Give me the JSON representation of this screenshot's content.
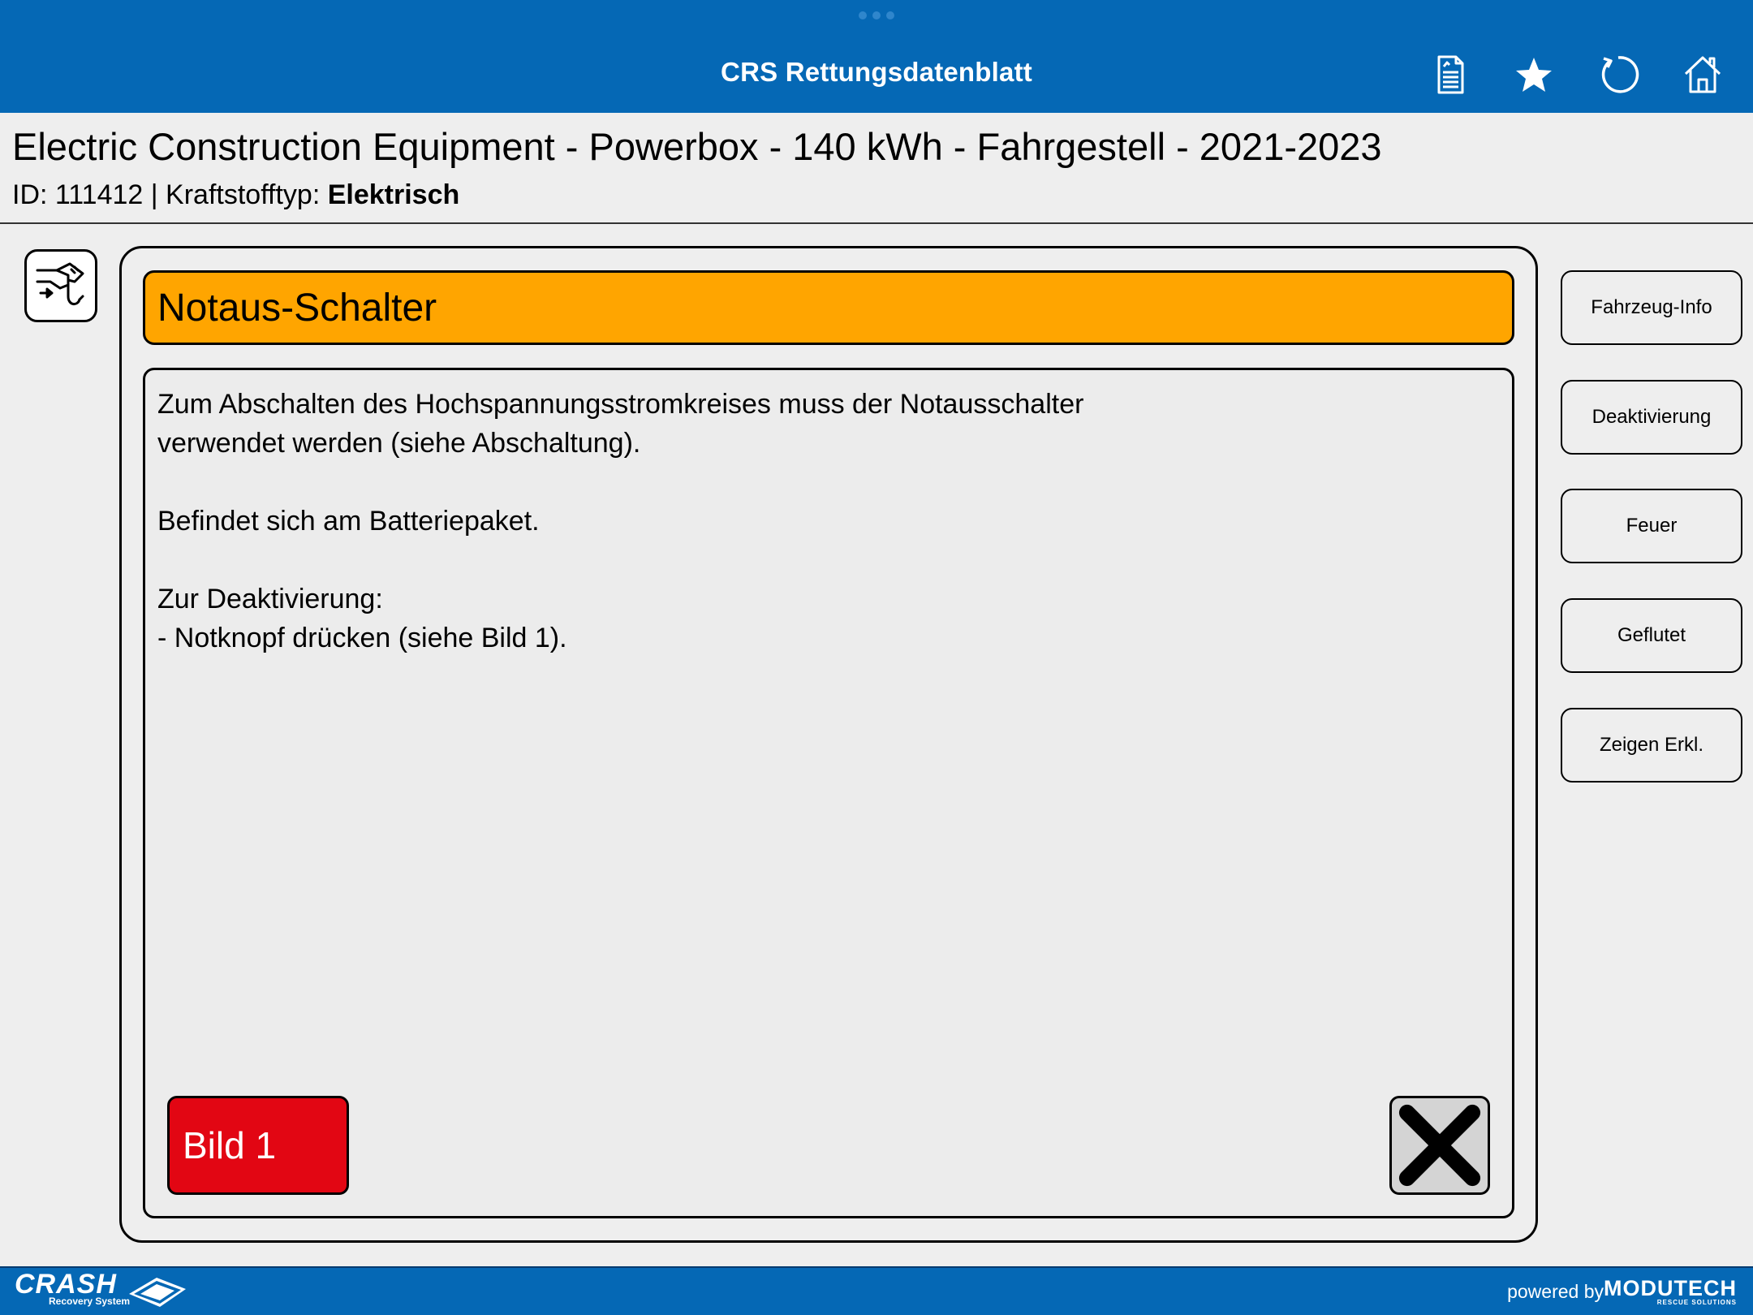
{
  "topbar": {
    "title": "CRS Rettungsdatenblatt",
    "icons": [
      "document-icon",
      "star-icon",
      "refresh-icon",
      "home-icon"
    ]
  },
  "vehicle": {
    "title": "Electric Construction Equipment - Powerbox - 140 kWh - Fahrgestell - 2021-2023",
    "id_label": "ID: 111412",
    "fuel_label": "| Kraftstofftyp:",
    "fuel_value": "Elektrisch"
  },
  "panel": {
    "heading": "Notaus-Schalter",
    "lines": {
      "l1": "Zum Abschalten des Hochspannungsstromkreises muss der Notausschalter",
      "l2": "verwendet werden (siehe Abschaltung).",
      "l3": "Befindet sich am Batteriepaket.",
      "l4": "Zur Deaktivierung:",
      "l5": "- Notknopf drücken (siehe Bild 1)."
    },
    "image_button": "Bild 1"
  },
  "nav": {
    "vehicle_info": "Fahrzeug-Info",
    "deactivation": "Deaktivierung",
    "fire": "Feuer",
    "flooded": "Geflutet",
    "legend": "Zeigen Erkl."
  },
  "footer": {
    "crash_word": "CRASH",
    "crash_sub": "Recovery System",
    "powered_by": "powered by",
    "brand": "MODUTECH",
    "brand_sub": "RESCUE SOLUTIONS"
  },
  "colors": {
    "primary_blue": "#0568b5",
    "header_orange": "#ffa500",
    "image_button_red": "#e20613"
  }
}
